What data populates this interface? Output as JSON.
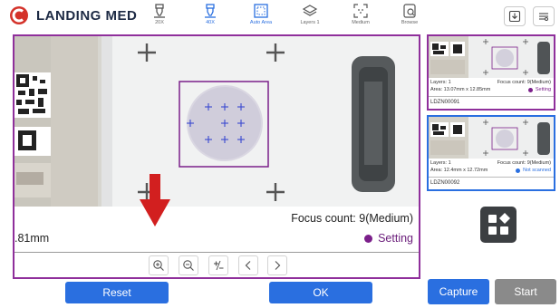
{
  "app": {
    "brand": "LANDING MED"
  },
  "toolbar": {
    "tools": [
      {
        "label": "20X",
        "icon": "objective-icon"
      },
      {
        "label": "40X",
        "icon": "objective-icon"
      },
      {
        "label": "Auto Area",
        "icon": "auto-area-icon"
      },
      {
        "label": "Layers 1",
        "icon": "layers-icon"
      },
      {
        "label": "Medium",
        "icon": "focus-icon"
      },
      {
        "label": "Browse",
        "icon": "browse-icon"
      }
    ],
    "active_tools": [
      "40X",
      "Auto Area"
    ]
  },
  "main": {
    "focus_count": "Focus count: 9(Medium)",
    "area_partial": ".81mm",
    "status": "Setting",
    "status_color": "#7b1f8a"
  },
  "controls": [
    "zoom-in-icon",
    "zoom-out-icon",
    "plus-minus-icon",
    "chevron-left-icon",
    "chevron-right-icon"
  ],
  "buttons": {
    "reset": "Reset",
    "ok": "OK",
    "capture": "Capture",
    "start": "Start"
  },
  "thumbnails": [
    {
      "layers": "Layers: 1",
      "focus": "Focus count: 9(Medium)",
      "area": "Area: 13.07mm x 12.85mm",
      "status": "Setting",
      "status_color": "#7b1f8a",
      "id": "LDZN00091",
      "label_text": "LDZN00091"
    },
    {
      "layers": "Layers: 1",
      "focus": "Focus count: 9(Medium)",
      "area": "Area: 12.4mm x 12.72mm",
      "status": "Not scanned",
      "status_color": "#2a6fe0",
      "id": "LDZN00092",
      "label_text": "LDZN00092"
    }
  ],
  "colors": {
    "accent_blue": "#2a6fe0",
    "purple": "#8f2f9b",
    "button_gray": "#8a8a8a",
    "brand_red": "#d4322a"
  }
}
